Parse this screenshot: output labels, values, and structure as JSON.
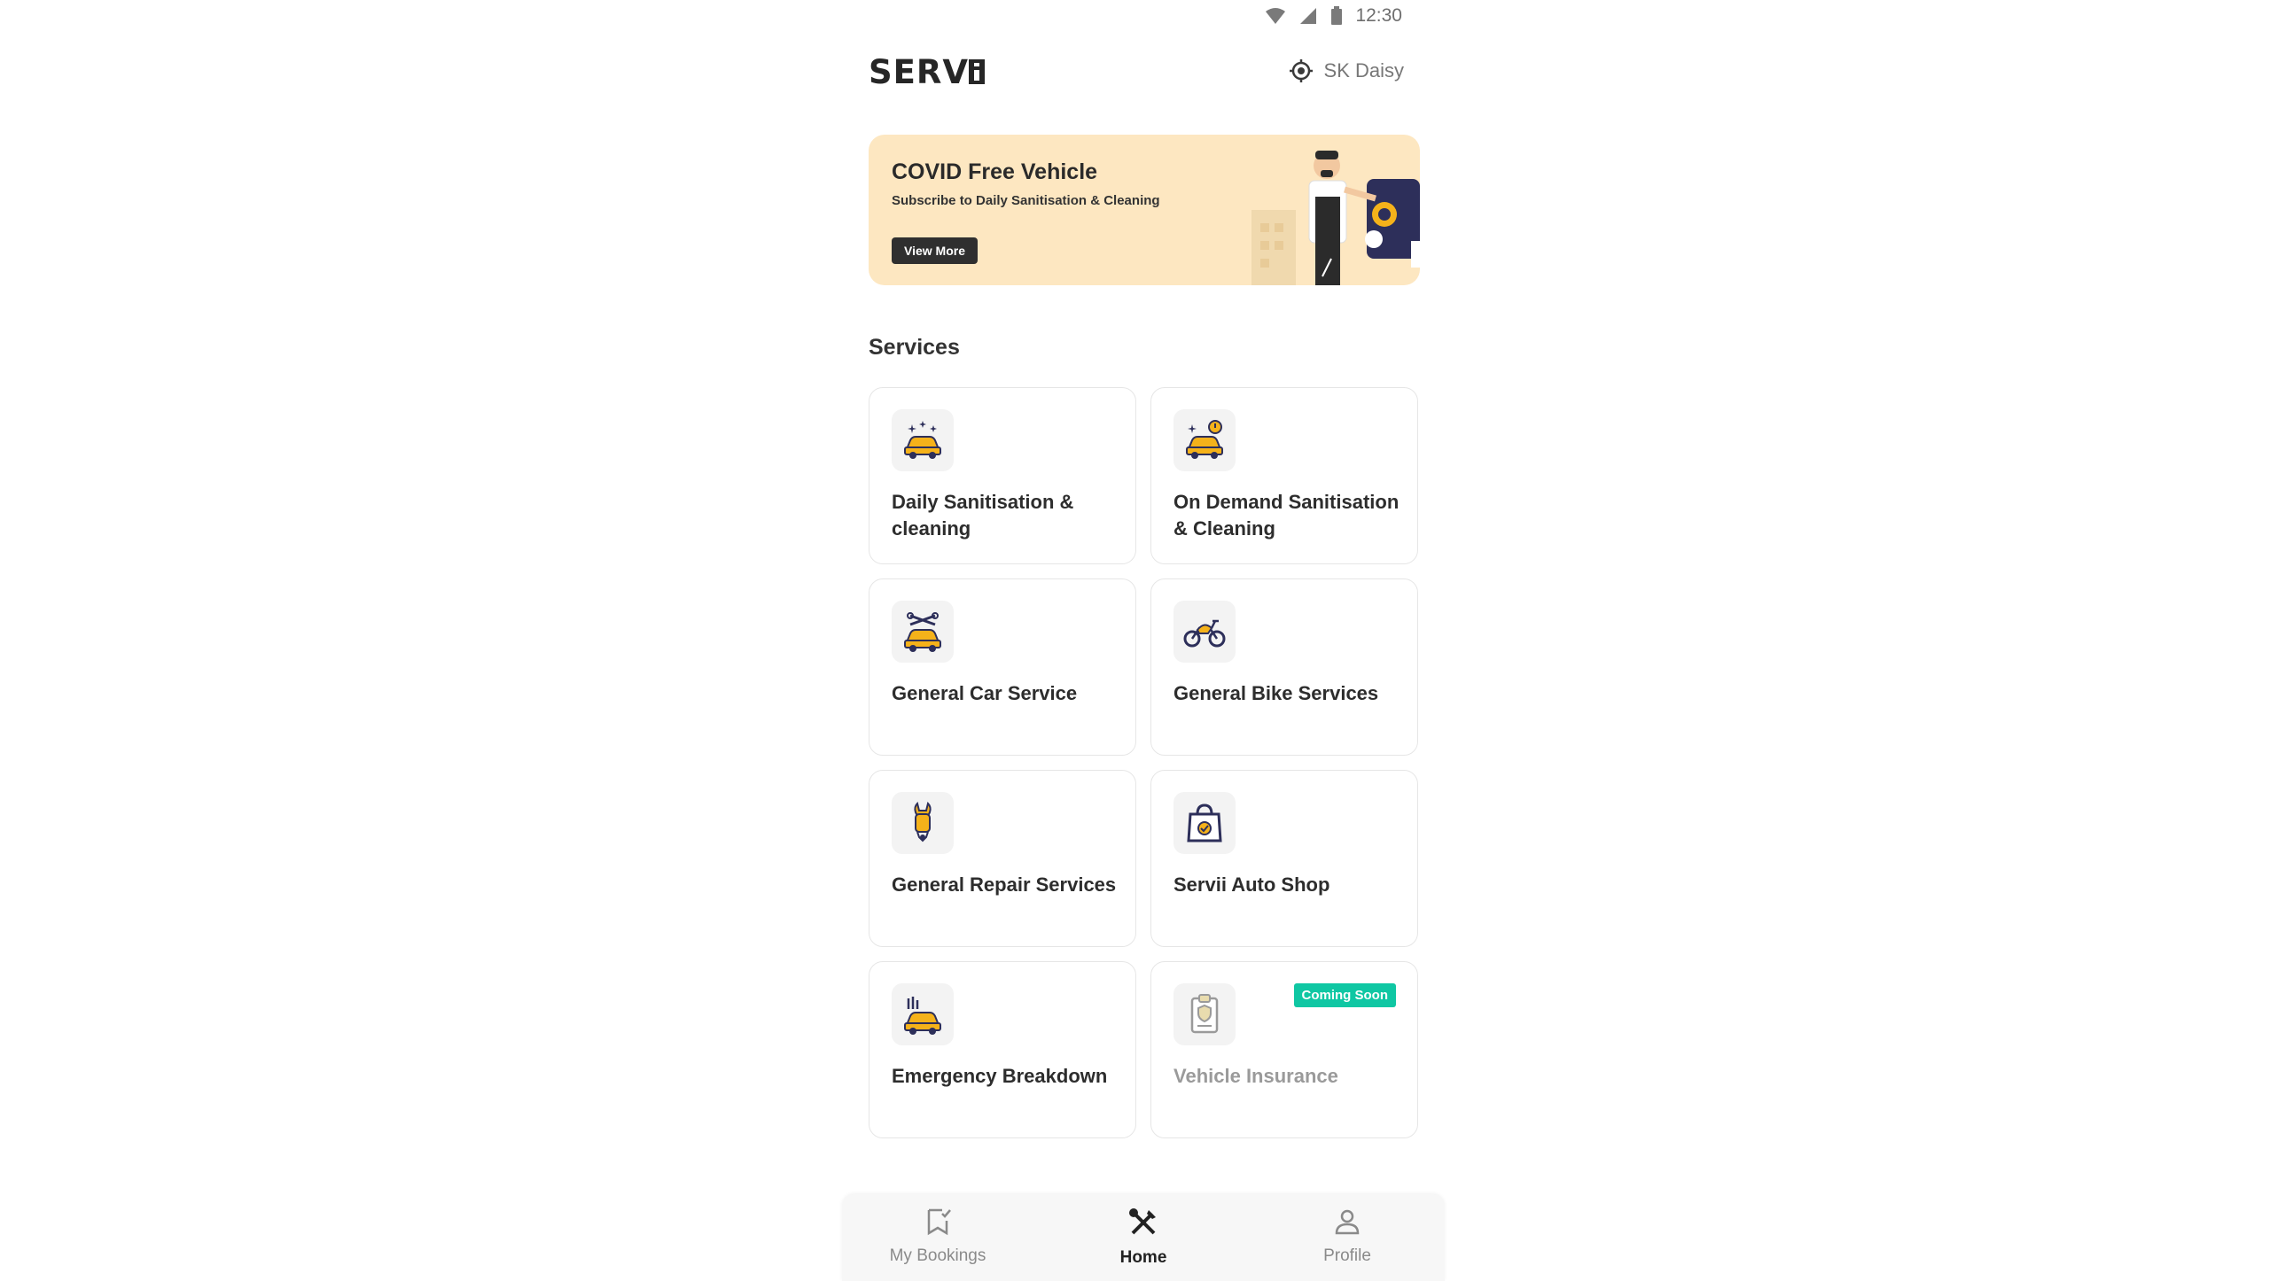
{
  "status_bar": {
    "time": "12:30",
    "icons": [
      "wifi-icon",
      "signal-icon",
      "battery-icon"
    ]
  },
  "header": {
    "logo": "SERV",
    "location_icon": "location-target-icon",
    "location_name": "SK Daisy"
  },
  "banner": {
    "title": "COVID Free Vehicle",
    "subtitle": "Subscribe to Daily Sanitisation & Cleaning",
    "button_label": "View More",
    "background_color": "#fde7c1"
  },
  "services": {
    "title": "Services",
    "items": [
      {
        "label": "Daily Sanitisation & cleaning",
        "icon": "sanitise-car-icon"
      },
      {
        "label": "On Demand Sanitisation & Cleaning",
        "icon": "on-demand-car-icon"
      },
      {
        "label": "General Car Service",
        "icon": "car-service-icon"
      },
      {
        "label": "General Bike Services",
        "icon": "bike-icon"
      },
      {
        "label": "General Repair Services",
        "icon": "spanner-icon"
      },
      {
        "label": "Servii Auto Shop",
        "icon": "shopping-bag-icon"
      },
      {
        "label": "Emergency Breakdown",
        "icon": "breakdown-car-icon"
      },
      {
        "label": "Vehicle Insurance",
        "icon": "insurance-clipboard-icon",
        "badge": "Coming Soon",
        "disabled": true
      }
    ]
  },
  "bottom_nav": {
    "items": [
      {
        "label": "My Bookings",
        "icon": "bookmark-check-icon",
        "active": false
      },
      {
        "label": "Home",
        "icon": "tools-icon",
        "active": true
      },
      {
        "label": "Profile",
        "icon": "person-icon",
        "active": false
      }
    ]
  },
  "colors": {
    "accent_yellow": "#f5b21a",
    "badge_green": "#0fc7a3",
    "dark": "#2f2f2f"
  }
}
